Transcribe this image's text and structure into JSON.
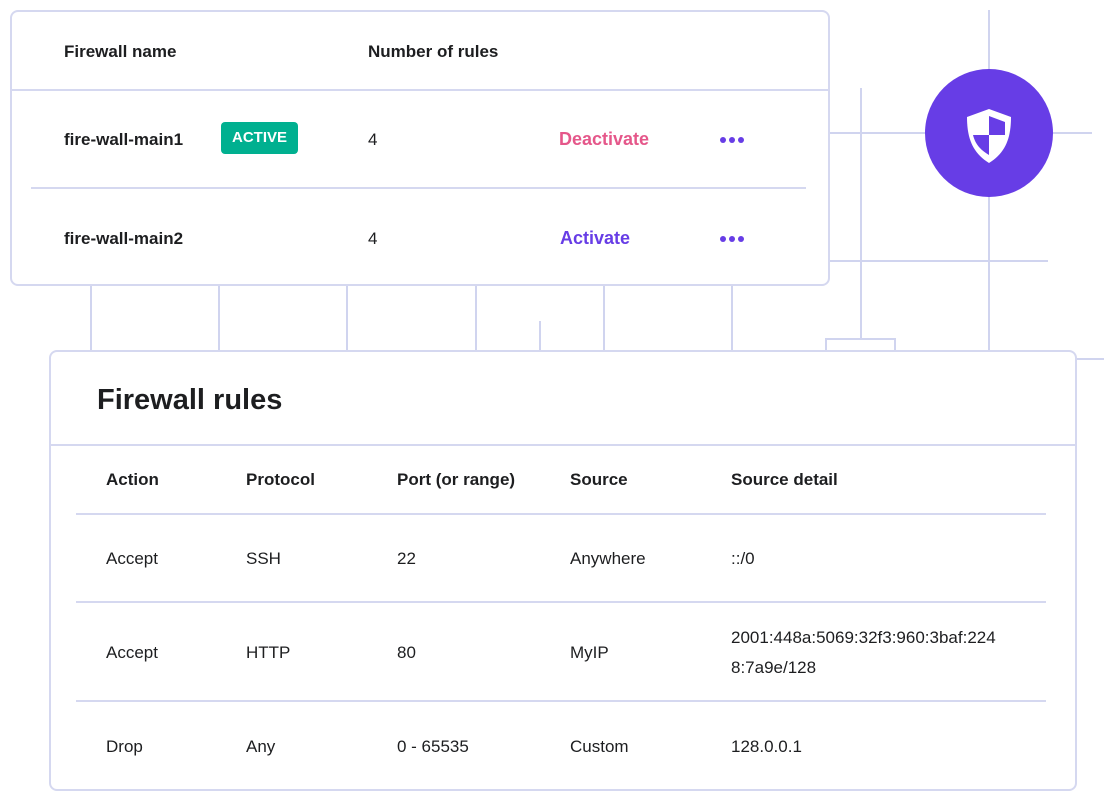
{
  "firewalls": {
    "headers": {
      "name": "Firewall name",
      "rules": "Number of rules"
    },
    "rows": [
      {
        "name": "fire-wall-main1",
        "badge": "ACTIVE",
        "rules": "4",
        "action": "Deactivate",
        "action_color": "#e5578a",
        "more": "more-options"
      },
      {
        "name": "fire-wall-main2",
        "badge": null,
        "rules": "4",
        "action": "Activate",
        "action_color": "#673de6",
        "more": "more-options"
      }
    ]
  },
  "shield": {
    "icon": "shield-icon",
    "color": "#673de6"
  },
  "rules": {
    "title": "Firewall rules",
    "headers": [
      "Action",
      "Protocol",
      "Port (or range)",
      "Source",
      "Source detail"
    ],
    "rows": [
      [
        "Accept",
        "SSH",
        "22",
        "Anywhere",
        "::/0"
      ],
      [
        "Accept",
        "HTTP",
        "80",
        "MyIP",
        "2001:448a:5069:32f3:960:3baf:224",
        "8:7a9e/128"
      ],
      [
        "Drop",
        "Any",
        "0 - 65535",
        "Custom",
        "128.0.0.1"
      ]
    ]
  },
  "colors": {
    "accent": "#673de6",
    "active_badge": "#00b090",
    "danger": "#e5578a",
    "line": "#d0d4ef"
  }
}
